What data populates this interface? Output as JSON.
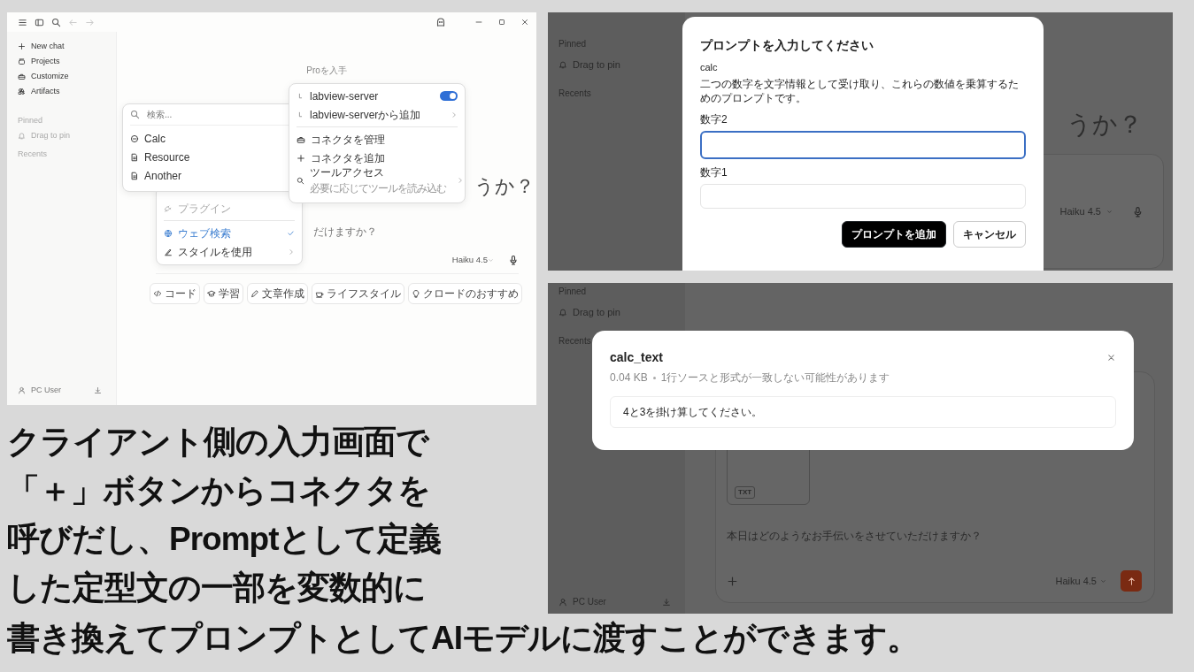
{
  "left_screenshot": {
    "sidebar": {
      "items": [
        {
          "label": "New chat",
          "kind": "new"
        },
        {
          "label": "Projects",
          "kind": "projects"
        },
        {
          "label": "Customize",
          "kind": "customize"
        },
        {
          "label": "Artifacts",
          "kind": "artifacts"
        }
      ],
      "pinned_heading": "Pinned",
      "drag_hint": "Drag to pin",
      "recents_heading": "Recents",
      "user": "PC User"
    },
    "main": {
      "upgrade_link": "Proを入手",
      "heading_fragment": "うか？",
      "placeholder": "だけますか？",
      "model": "Haiku 4.5",
      "chips": [
        {
          "label": "コード",
          "kind": "code"
        },
        {
          "label": "学習",
          "kind": "learn"
        },
        {
          "label": "文章作成",
          "kind": "write"
        },
        {
          "label": "ライフスタイル",
          "kind": "life"
        },
        {
          "label": "クロードのおすすめ",
          "kind": "idea"
        }
      ]
    },
    "tools_menu": {
      "items": [
        {
          "label": "プラグイン",
          "kind": "plugin",
          "disabled": true,
          "checked": false,
          "submenu": false
        },
        {
          "label": "ウェブ検索",
          "kind": "web",
          "disabled": false,
          "checked": true,
          "submenu": false
        },
        {
          "label": "スタイルを使用",
          "kind": "style",
          "disabled": false,
          "checked": false,
          "submenu": true
        }
      ]
    },
    "prompt_menu": {
      "search_placeholder": "検索...",
      "items": [
        {
          "label": "Calc",
          "kind": "prompt"
        },
        {
          "label": "Resource",
          "kind": "resource"
        },
        {
          "label": "Another",
          "kind": "resource"
        }
      ]
    },
    "connector_menu": {
      "server_toggle": {
        "label": "labview-server",
        "on": true
      },
      "server_submenu": {
        "label": "labview-serverから追加"
      },
      "actions": [
        {
          "label": "コネクタを管理",
          "kind": "manage"
        },
        {
          "label": "コネクタを追加",
          "kind": "add"
        },
        {
          "label": "ツールアクセス",
          "sublabel": "必要に応じてツールを読み込む",
          "kind": "tools"
        }
      ]
    }
  },
  "right_top_screenshot": {
    "sidebar": {
      "pinned_heading": "Pinned",
      "drag_hint": "Drag to pin",
      "recents_heading": "Recents"
    },
    "main": {
      "heading_fragment": "うか？",
      "model": "Haiku 4.5"
    },
    "modal": {
      "title": "プロンプトを入力してください",
      "prompt_name": "calc",
      "description": "二つの数字を文字情報として受け取り、これらの数値を乗算するためのプロンプトです。",
      "fields": [
        {
          "label": "数字2",
          "focused": true
        },
        {
          "label": "数字1",
          "focused": false
        }
      ],
      "buttons": [
        {
          "label": "プロンプトを追加",
          "kind": "primary"
        },
        {
          "label": "キャンセル",
          "kind": "secondary"
        }
      ]
    }
  },
  "right_bottom_screenshot": {
    "sidebar": {
      "pinned_heading": "Pinned",
      "drag_hint": "Drag to pin",
      "recents_heading": "Recents",
      "user": "PC User"
    },
    "main": {
      "attachment_badge": "TXT",
      "prompt_text": "本日はどのようなお手伝いをさせていただけますか？",
      "model": "Haiku 4.5"
    },
    "modal": {
      "title": "calc_text",
      "size": "0.04 KB",
      "meta": "1行ソースと形式が一致しない可能性があります",
      "content": "4と3を掛け算してください。"
    }
  },
  "caption": {
    "lines": [
      "クライアント側の入力画面で",
      "「＋」ボタンからコネクタを",
      "呼びだし、Promptとして定義",
      "した定型文の一部を変数的に",
      "書き換えてプロンプトとしてAIモデルに渡すことができます。"
    ]
  }
}
